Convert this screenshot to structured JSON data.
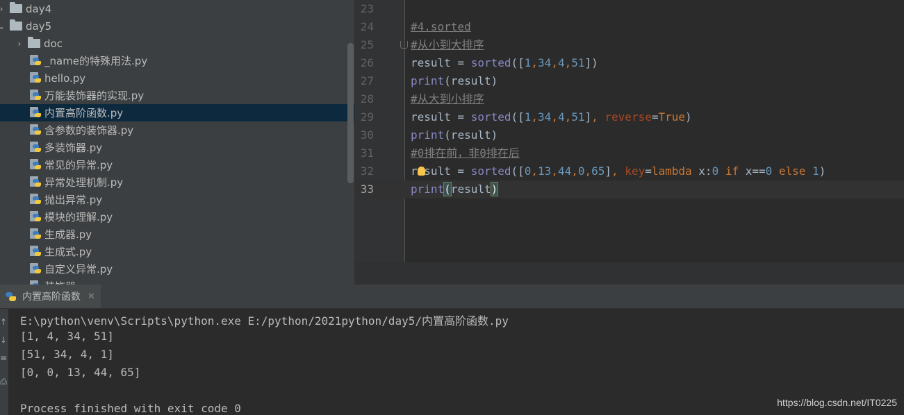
{
  "project_tree": {
    "items": [
      {
        "label": "day4",
        "kind": "folder",
        "expanded": false
      },
      {
        "label": "day5",
        "kind": "folder",
        "expanded": true
      },
      {
        "label": "doc",
        "kind": "folder",
        "expanded": false
      },
      {
        "label": "_name的特殊用法.py",
        "kind": "python-file"
      },
      {
        "label": "hello.py",
        "kind": "python-file"
      },
      {
        "label": "万能装饰器的实现.py",
        "kind": "python-file"
      },
      {
        "label": "内置高阶函数.py",
        "kind": "python-file",
        "selected": true
      },
      {
        "label": "含参数的装饰器.py",
        "kind": "python-file"
      },
      {
        "label": "多装饰器.py",
        "kind": "python-file"
      },
      {
        "label": "常见的异常.py",
        "kind": "python-file"
      },
      {
        "label": "异常处理机制.py",
        "kind": "python-file"
      },
      {
        "label": "抛出异常.py",
        "kind": "python-file"
      },
      {
        "label": "模块的理解.py",
        "kind": "python-file"
      },
      {
        "label": "生成器.py",
        "kind": "python-file"
      },
      {
        "label": "生成式.py",
        "kind": "python-file"
      },
      {
        "label": "自定义异常.py",
        "kind": "python-file"
      },
      {
        "label": "装饰器",
        "kind": "python-file"
      }
    ]
  },
  "editor": {
    "current_line": "33",
    "lines": [
      {
        "num": "23",
        "tokens": []
      },
      {
        "num": "24",
        "tokens": [
          {
            "t": "#4.sorted",
            "c": "cm"
          }
        ]
      },
      {
        "num": "25",
        "tokens": [
          {
            "t": "#从小到大排序",
            "c": "cm"
          }
        ]
      },
      {
        "num": "26",
        "tokens": [
          {
            "t": "result = ",
            "c": ""
          },
          {
            "t": "sorted",
            "c": "bi"
          },
          {
            "t": "([",
            "c": ""
          },
          {
            "t": "1",
            "c": "nm"
          },
          {
            "t": ",",
            "c": "kw"
          },
          {
            "t": "34",
            "c": "nm"
          },
          {
            "t": ",",
            "c": "kw"
          },
          {
            "t": "4",
            "c": "nm"
          },
          {
            "t": ",",
            "c": "kw"
          },
          {
            "t": "51",
            "c": "nm"
          },
          {
            "t": "])",
            "c": ""
          }
        ]
      },
      {
        "num": "27",
        "tokens": [
          {
            "t": "print",
            "c": "bi"
          },
          {
            "t": "(result)",
            "c": ""
          }
        ]
      },
      {
        "num": "28",
        "tokens": [
          {
            "t": "#从大到小排序",
            "c": "cm"
          }
        ]
      },
      {
        "num": "29",
        "tokens": [
          {
            "t": "result = ",
            "c": ""
          },
          {
            "t": "sorted",
            "c": "bi"
          },
          {
            "t": "([",
            "c": ""
          },
          {
            "t": "1",
            "c": "nm"
          },
          {
            "t": ",",
            "c": "kw"
          },
          {
            "t": "34",
            "c": "nm"
          },
          {
            "t": ",",
            "c": "kw"
          },
          {
            "t": "4",
            "c": "nm"
          },
          {
            "t": ",",
            "c": "kw"
          },
          {
            "t": "51",
            "c": "nm"
          },
          {
            "t": "]",
            "c": ""
          },
          {
            "t": ", ",
            "c": "kw"
          },
          {
            "t": "reverse",
            "c": "kwa"
          },
          {
            "t": "=",
            "c": ""
          },
          {
            "t": "True",
            "c": "kw"
          },
          {
            "t": ")",
            "c": ""
          }
        ]
      },
      {
        "num": "30",
        "tokens": [
          {
            "t": "print",
            "c": "bi"
          },
          {
            "t": "(result)",
            "c": ""
          }
        ]
      },
      {
        "num": "31",
        "tokens": [
          {
            "t": "#0排在前，非0排在后",
            "c": "cm"
          }
        ]
      },
      {
        "num": "32",
        "tokens": [
          {
            "t": "result = ",
            "c": ""
          },
          {
            "t": "sorted",
            "c": "bi"
          },
          {
            "t": "([",
            "c": ""
          },
          {
            "t": "0",
            "c": "nm"
          },
          {
            "t": ",",
            "c": "kw"
          },
          {
            "t": "13",
            "c": "nm"
          },
          {
            "t": ",",
            "c": "kw"
          },
          {
            "t": "44",
            "c": "nm"
          },
          {
            "t": ",",
            "c": "kw"
          },
          {
            "t": "0",
            "c": "nm"
          },
          {
            "t": ",",
            "c": "kw"
          },
          {
            "t": "65",
            "c": "nm"
          },
          {
            "t": "]",
            "c": ""
          },
          {
            "t": ", ",
            "c": "kw"
          },
          {
            "t": "key",
            "c": "kwa"
          },
          {
            "t": "=",
            "c": ""
          },
          {
            "t": "lambda ",
            "c": "kw"
          },
          {
            "t": "x:",
            "c": ""
          },
          {
            "t": "0 ",
            "c": "nm"
          },
          {
            "t": "if ",
            "c": "kw"
          },
          {
            "t": "x==",
            "c": ""
          },
          {
            "t": "0 ",
            "c": "nm"
          },
          {
            "t": "else ",
            "c": "kw"
          },
          {
            "t": "1",
            "c": "nm"
          },
          {
            "t": ")",
            "c": ""
          }
        ],
        "bulb": true
      },
      {
        "num": "33",
        "tokens": [
          {
            "t": "print",
            "c": "bi"
          },
          {
            "t": "(",
            "c": "hl"
          },
          {
            "t": "result",
            "c": ""
          },
          {
            "t": ")",
            "c": "hl"
          }
        ]
      }
    ]
  },
  "run_panel": {
    "tab_label": "内置高阶函数",
    "output_lines": [
      "E:\\python\\venv\\Scripts\\python.exe E:/python/2021python/day5/内置高阶函数.py",
      "[1, 4, 34, 51]",
      "[51, 34, 4, 1]",
      "[0, 0, 13, 44, 65]",
      "",
      "Process finished with exit code 0"
    ]
  },
  "watermark": "https://blog.csdn.net/IT0225",
  "colors": {
    "comment": "#808080",
    "builtin": "#8888c6",
    "number": "#6897bb",
    "keyword": "#cc7832",
    "param": "#aa4926",
    "selection": "#0d293e"
  }
}
